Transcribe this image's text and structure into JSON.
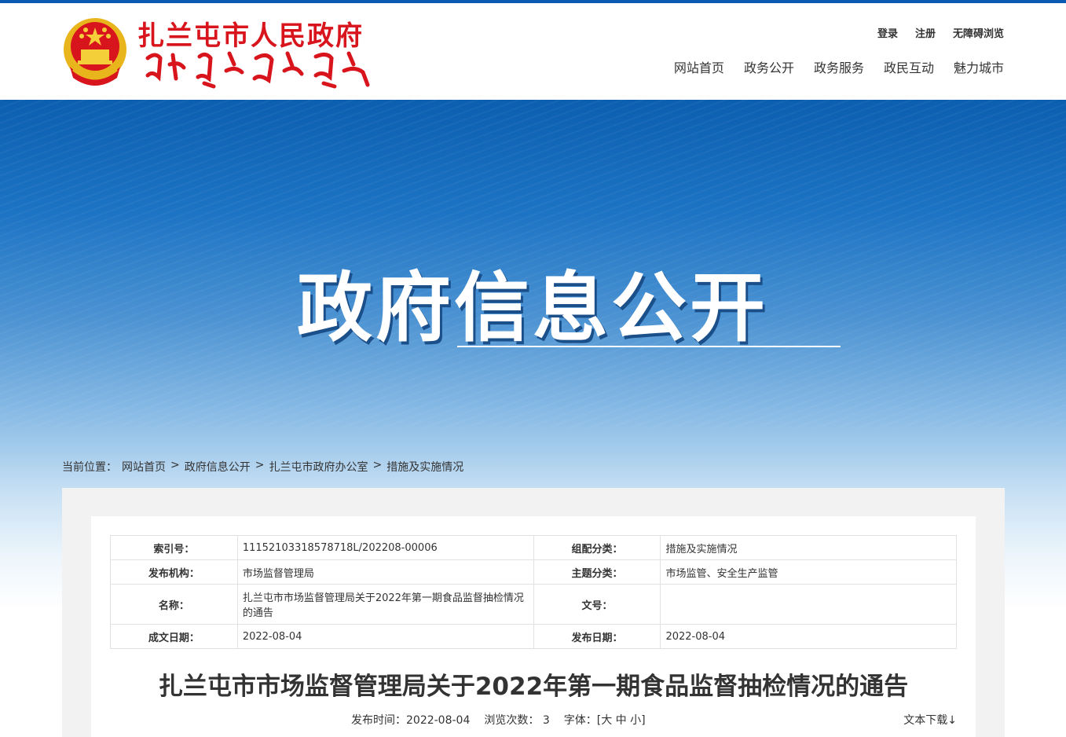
{
  "header": {
    "site_name": "扎兰屯市人民政府",
    "site_name_mongolian": "ᠵᠠᠯᠠᠨᠲᠤᠨ ᠬᠣᠲᠠ",
    "user_links": [
      "登录",
      "注册",
      "无障碍浏览"
    ],
    "nav": [
      "网站首页",
      "政务公开",
      "政务服务",
      "政民互动",
      "魅力城市"
    ]
  },
  "banner": {
    "title": "政府信息公开"
  },
  "breadcrumb": {
    "prefix": "当前位置：",
    "items": [
      "网站首页",
      "政府信息公开",
      "扎兰屯市政府办公室",
      "措施及实施情况"
    ],
    "sep": ">"
  },
  "meta": {
    "index_label": "索引号：",
    "index_value": "11152103318578718L/202208-00006",
    "group_label": "组配分类：",
    "group_value": "措施及实施情况",
    "org_label": "发布机构：",
    "org_value": "市场监督管理局",
    "topic_label": "主题分类：",
    "topic_value": "市场监管、安全生产监管",
    "name_label": "名称：",
    "name_value": "扎兰屯市市场监督管理局关于2022年第一期食品监督抽检情况的通告",
    "doc_label": "文号：",
    "doc_value": "",
    "written_label": "成文日期：",
    "written_value": "2022-08-04",
    "pub_label": "发布日期：",
    "pub_value": "2022-08-04"
  },
  "article": {
    "title": "扎兰屯市市场监督管理局关于2022年第一期食品监督抽检情况的通告",
    "publish_time": "发布时间：2022-08-04",
    "views_label": "浏览次数：",
    "views": "3",
    "font_label": "字体：[大 中 小]",
    "download": "文本下载↓"
  },
  "colors": {
    "brand_red": "#d8141c",
    "brand_blue": "#0b5bb5"
  }
}
